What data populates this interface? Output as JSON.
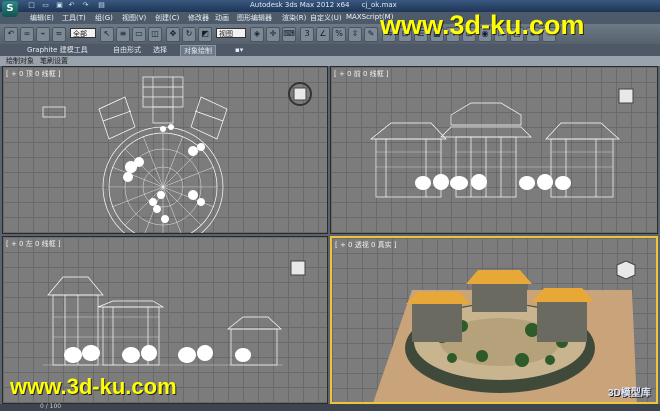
{
  "app": {
    "title": "Autodesk 3ds Max  2012 x64",
    "file": "cj_ok.max",
    "logo": "S"
  },
  "menus": [
    "编辑(E)",
    "工具(T)",
    "组(G)",
    "视图(V)",
    "创建(C)",
    "修改器",
    "动画",
    "图形编辑器",
    "渲染(R)",
    "自定义(U)",
    "MAXScript(M)"
  ],
  "toolbar": {
    "selection_filter": "全部",
    "reference_coord": "视图"
  },
  "ribbon": {
    "tabs": [
      "Graphite 建模工具",
      "自由形式",
      "选择",
      "对象绘制"
    ],
    "sub_items": [
      "绘制对象",
      "笔刷设置"
    ]
  },
  "viewports": {
    "top": "[ + 0 顶 0 线框 ]",
    "front": "[ + 0 前 0 线框 ]",
    "left": "[ + 0 左 0 线框 ]",
    "perspective": "[ + 0 透视 0 真实 ]"
  },
  "watermarks": {
    "top": "www.3d-ku.com",
    "bottom": "www.3d-ku.com",
    "corner": "3D模型库"
  },
  "status": {
    "text": "0 / 100"
  },
  "colors": {
    "roof": "#e8a838",
    "ground": "#c9a37a",
    "wall": "#3f4a3a",
    "active_border": "#f0c43a",
    "watermark": "#ffff00"
  }
}
